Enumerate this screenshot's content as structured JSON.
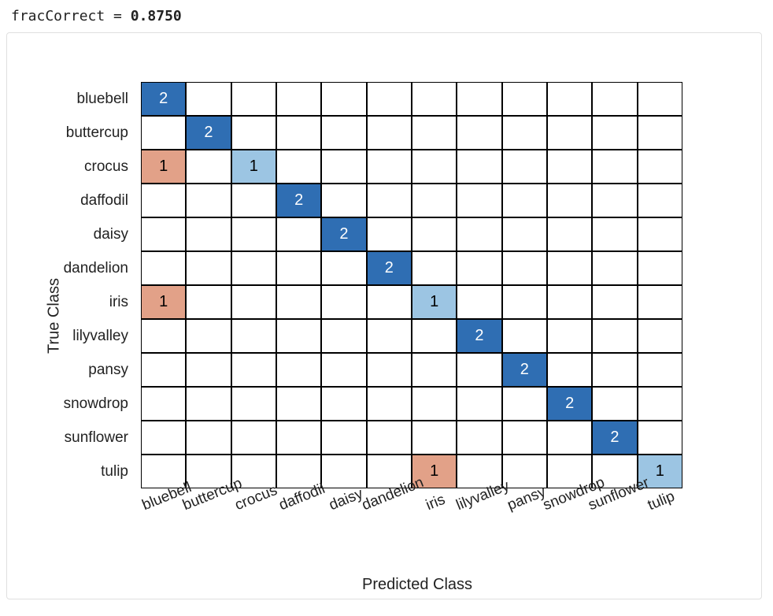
{
  "output": {
    "varname": "fracCorrect",
    "equals": " = ",
    "value": "0.8750"
  },
  "chart_data": {
    "type": "heatmap",
    "title": "",
    "xlabel": "Predicted Class",
    "ylabel": "True Class",
    "categories": [
      "bluebell",
      "buttercup",
      "crocus",
      "daffodil",
      "daisy",
      "dandelion",
      "iris",
      "lilyvalley",
      "pansy",
      "snowdrop",
      "sunflower",
      "tulip"
    ],
    "row_categories": [
      "bluebell",
      "buttercup",
      "crocus",
      "daffodil",
      "daisy",
      "dandelion",
      "iris",
      "lilyvalley",
      "pansy",
      "snowdrop",
      "sunflower",
      "tulip"
    ],
    "matrix": [
      [
        2,
        0,
        0,
        0,
        0,
        0,
        0,
        0,
        0,
        0,
        0,
        0
      ],
      [
        0,
        2,
        0,
        0,
        0,
        0,
        0,
        0,
        0,
        0,
        0,
        0
      ],
      [
        1,
        0,
        1,
        0,
        0,
        0,
        0,
        0,
        0,
        0,
        0,
        0
      ],
      [
        0,
        0,
        0,
        2,
        0,
        0,
        0,
        0,
        0,
        0,
        0,
        0
      ],
      [
        0,
        0,
        0,
        0,
        2,
        0,
        0,
        0,
        0,
        0,
        0,
        0
      ],
      [
        0,
        0,
        0,
        0,
        0,
        2,
        0,
        0,
        0,
        0,
        0,
        0
      ],
      [
        1,
        0,
        0,
        0,
        0,
        0,
        1,
        0,
        0,
        0,
        0,
        0
      ],
      [
        0,
        0,
        0,
        0,
        0,
        0,
        0,
        2,
        0,
        0,
        0,
        0
      ],
      [
        0,
        0,
        0,
        0,
        0,
        0,
        0,
        0,
        2,
        0,
        0,
        0
      ],
      [
        0,
        0,
        0,
        0,
        0,
        0,
        0,
        0,
        0,
        2,
        0,
        0
      ],
      [
        0,
        0,
        0,
        0,
        0,
        0,
        0,
        0,
        0,
        0,
        2,
        0
      ],
      [
        0,
        0,
        0,
        0,
        0,
        0,
        1,
        0,
        0,
        0,
        0,
        1
      ]
    ],
    "colors": {
      "diagonal_2": "#2f6eb3",
      "diagonal_1": "#9cc5e diag1",
      "offdiag_1": "#e2a188"
    }
  }
}
